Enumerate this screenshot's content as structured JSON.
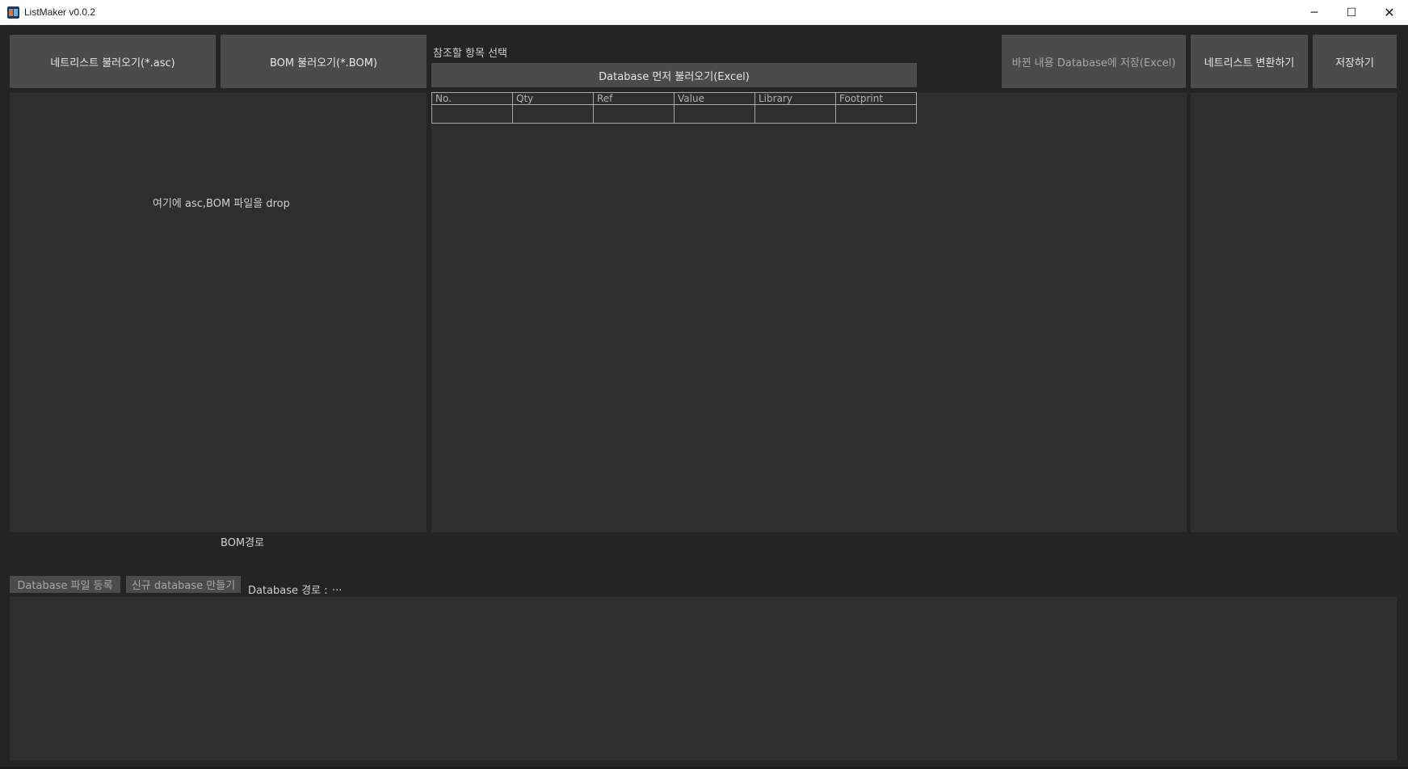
{
  "window": {
    "title": "ListMaker v0.0.2",
    "icon": "app-icon",
    "minimize": "─",
    "maximize": "☐",
    "close": "✕"
  },
  "toolbar": {
    "load_netlist": "네트리스트 불러오기(*.asc)",
    "load_bom": "BOM 불러오기(*.BOM)",
    "ref_select_label": "참조할 항목 선택",
    "load_db_first": "Database 먼저 불러오기(Excel)",
    "save_changes_db": "바뀐 내용 Database에 저장(Excel)",
    "convert_netlist": "네트리스트 변환하기",
    "save": "저장하기"
  },
  "drop_area": {
    "hint": "여기에 asc,BOM 파일을 drop"
  },
  "table": {
    "columns": [
      "No.",
      "Qty",
      "Ref",
      "Value",
      "Library",
      "Footprint"
    ],
    "rows": [
      [
        "",
        "",
        "",
        "",
        "",
        ""
      ]
    ]
  },
  "bom_path": {
    "label": "BOM경로"
  },
  "database": {
    "register_button": "Database 파일 등록",
    "create_button": "신규 database 만들기",
    "path_label": "Database 경로 :",
    "path_value": "..."
  },
  "colors": {
    "background": "#242424",
    "panel": "#2e2e2e",
    "button": "#4b4b4b",
    "text": "#e6e6e6",
    "dim_text": "#a6a6a6"
  }
}
